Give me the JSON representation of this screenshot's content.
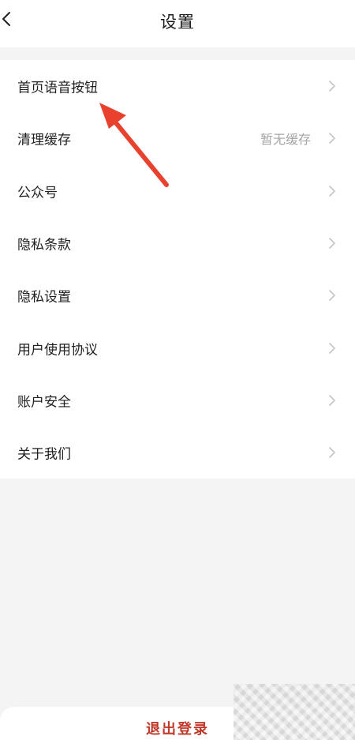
{
  "header": {
    "title": "设置",
    "back_icon": "chevron-left-icon"
  },
  "settings": {
    "items": [
      {
        "label": "首页语音按钮",
        "value": "",
        "icon": "chevron-right-icon"
      },
      {
        "label": "清理缓存",
        "value": "暂无缓存",
        "icon": "chevron-right-icon"
      },
      {
        "label": "公众号",
        "value": "",
        "icon": "chevron-right-icon"
      },
      {
        "label": "隐私条款",
        "value": "",
        "icon": "chevron-right-icon"
      },
      {
        "label": "隐私设置",
        "value": "",
        "icon": "chevron-right-icon"
      },
      {
        "label": "用户使用协议",
        "value": "",
        "icon": "chevron-right-icon"
      },
      {
        "label": "账户安全",
        "value": "",
        "icon": "chevron-right-icon"
      },
      {
        "label": "关于我们",
        "value": "",
        "icon": "chevron-right-icon"
      }
    ]
  },
  "footer": {
    "logout_label": "退出登录"
  },
  "colors": {
    "accent": "#c0392b",
    "annotation_arrow": "#e8422f",
    "background": "#f4f4f4",
    "value_text": "#a5a5a5"
  }
}
